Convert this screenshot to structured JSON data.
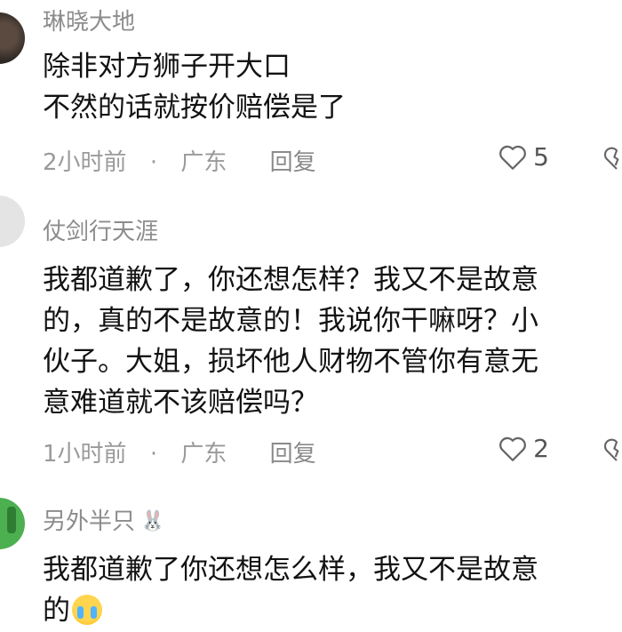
{
  "comments": [
    {
      "username": "琳晓大地",
      "lines": [
        "除非对方狮子开大口",
        "不然的话就按价赔偿是了"
      ],
      "time": "2小时前",
      "separator": "·",
      "location": "广东",
      "reply": "回复",
      "likes": "5"
    },
    {
      "username": "仗剑行天涯",
      "lines": [
        "我都道歉了，你还想怎样？我又不是故意",
        "的，真的不是故意的！我说你干嘛呀？小",
        "伙子。大姐，损坏他人财物不管你有意无",
        "意难道就不该赔偿吗？"
      ],
      "time": "1小时前",
      "separator": "·",
      "location": "广东",
      "reply": "回复",
      "likes": "2"
    },
    {
      "username": "另外半只",
      "lines": [
        "我都道歉了你还想怎么样，我又不是故意",
        "的"
      ],
      "emoji": "crying-face-emoji"
    }
  ],
  "icons": {
    "like": "heart-outline-icon",
    "dislike": "broken-heart-icon",
    "badge": "bunny-icon"
  },
  "colors": {
    "username": "#8c8c8c",
    "meta": "#9a9a9a",
    "text": "#121212"
  }
}
